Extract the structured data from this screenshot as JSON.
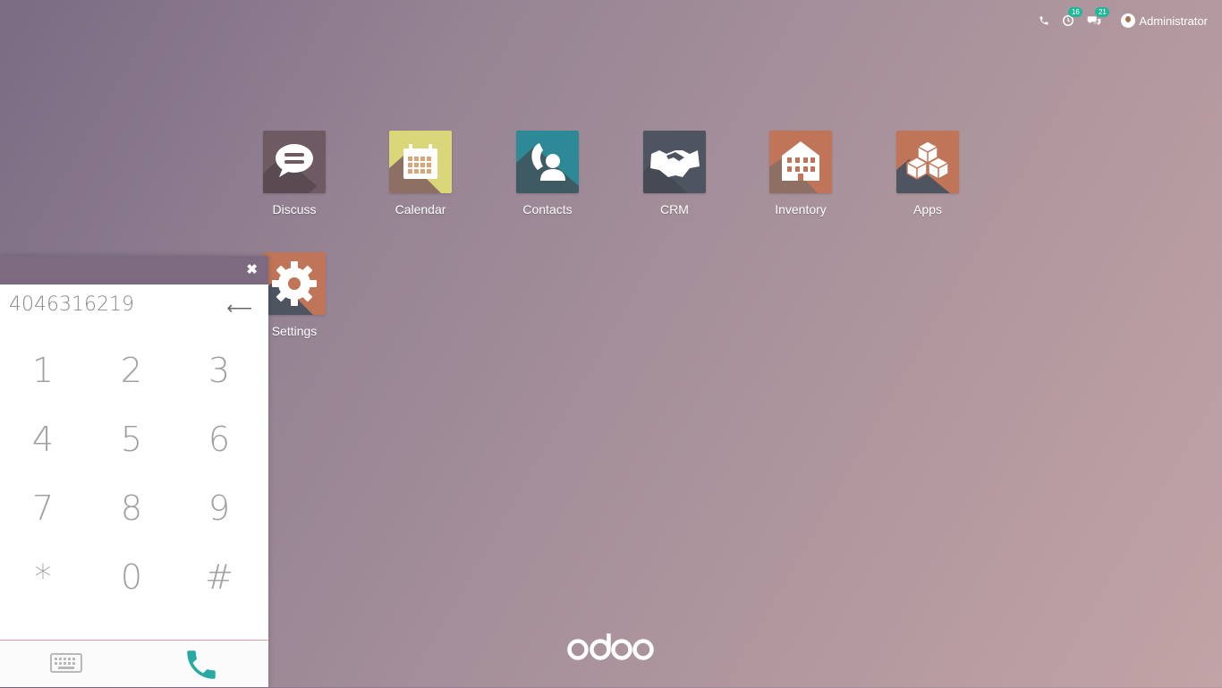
{
  "systray": {
    "phone_icon": "phone-icon",
    "activities_count": "16",
    "messages_count": "21",
    "user_name": "Administrator"
  },
  "apps": [
    {
      "label": "Discuss",
      "color": "#6e5a63",
      "icon": "chat-bubble-icon"
    },
    {
      "label": "Calendar",
      "color": "#d9d77a",
      "icon": "calendar-icon"
    },
    {
      "label": "Contacts",
      "color": "#2d8996",
      "icon": "contacts-icon"
    },
    {
      "label": "CRM",
      "color": "#4e5560",
      "icon": "handshake-icon"
    },
    {
      "label": "Inventory",
      "color": "#c07558",
      "icon": "building-icon"
    },
    {
      "label": "Apps",
      "color": "#c07558",
      "icon": "cubes-icon"
    },
    {
      "label": "Settings",
      "color": "#c07558",
      "icon": "gear-icon"
    }
  ],
  "dialer": {
    "close_label": "✖",
    "number": "4046316219",
    "backspace_label": "⟵",
    "keys": [
      "1",
      "2",
      "3",
      "4",
      "5",
      "6",
      "7",
      "8",
      "9",
      "*",
      "0",
      "#"
    ],
    "call_color": "#2aa9a4"
  },
  "logo_text": "odoo"
}
